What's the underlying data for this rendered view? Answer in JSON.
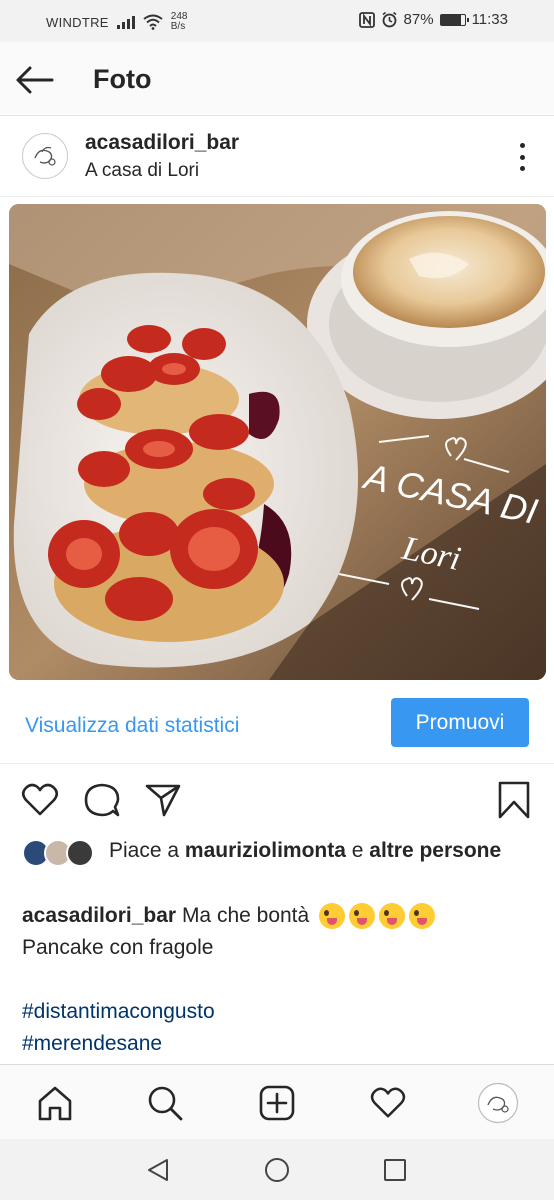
{
  "status_bar": {
    "carrier": "WINDTRE",
    "net_speed_value": "248",
    "net_speed_unit": "B/s",
    "battery_percent": "87%",
    "battery_level": 0.87,
    "time": "11:33",
    "icons": [
      "signal-icon",
      "wifi-icon",
      "nfc-icon",
      "alarm-icon",
      "battery-icon"
    ]
  },
  "header": {
    "title": "Foto",
    "back_icon": "arrow-left-icon"
  },
  "post": {
    "username": "acasadilori_bar",
    "location": "A casa di Lori",
    "photo_overlay_line1": "A CASA DI",
    "photo_overlay_line2": "Lori"
  },
  "stats": {
    "link_label": "Visualizza dati statistici",
    "promote_label": "Promuovi"
  },
  "likes": {
    "prefix": "Piace a ",
    "user": "mauriziolimonta",
    "middle": " e ",
    "others": "altre persone"
  },
  "caption": {
    "username": "acasadilori_bar",
    "text": "Ma che bontà",
    "emoji_count": 4,
    "line2": "Pancake con fragole",
    "hashtags": [
      "#distantimacongusto",
      "#merendesane"
    ]
  },
  "colors": {
    "link_blue": "#3897f0",
    "hashtag_blue": "#003569",
    "text": "#262626"
  }
}
